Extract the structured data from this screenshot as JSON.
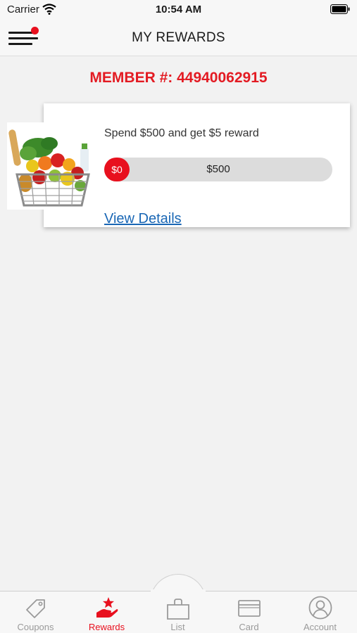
{
  "status_bar": {
    "carrier": "Carrier",
    "time": "10:54 AM"
  },
  "header": {
    "title": "MY REWARDS",
    "menu_icon": "hamburger-menu-icon",
    "notification_dot_color": "#e8101e"
  },
  "member": {
    "text": "MEMBER #: 44940062915"
  },
  "reward": {
    "image": "grocery-basket-image",
    "description": "Spend $500 and get $5 reward",
    "progress_start_label": "$0",
    "progress_goal_label": "$500",
    "progress_fraction": 0,
    "link_label": "View Details"
  },
  "tabs": [
    {
      "label": "Coupons",
      "icon": "tag-icon",
      "active": false
    },
    {
      "label": "Rewards",
      "icon": "rewards-star-hand-icon",
      "active": true
    },
    {
      "label": "List",
      "icon": "list-bag-icon",
      "active": false
    },
    {
      "label": "Card",
      "icon": "card-icon",
      "active": false
    },
    {
      "label": "Account",
      "icon": "account-icon",
      "active": false
    }
  ],
  "colors": {
    "accent": "#e8101e",
    "member_text": "#e31b23",
    "link": "#1a67b5",
    "inactive_tab": "#9a9a9a"
  }
}
